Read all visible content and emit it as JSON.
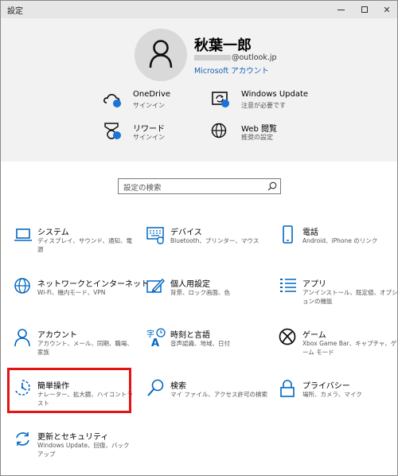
{
  "window": {
    "title": "設定"
  },
  "account": {
    "name": "秋葉一郎",
    "email_domain": "@outlook.jp",
    "ms_account_link": "Microsoft アカウント"
  },
  "quick": [
    {
      "title": "OneDrive",
      "subtitle": "サインイン",
      "icon": "onedrive-icon"
    },
    {
      "title": "Windows Update",
      "subtitle": "注意が必要です",
      "icon": "windows-update-icon"
    },
    {
      "title": "リワード",
      "subtitle": "サインイン",
      "icon": "rewards-icon"
    },
    {
      "title": "Web 閲覧",
      "subtitle": "推奨の設定",
      "icon": "globe-icon"
    }
  ],
  "search": {
    "placeholder": "設定の検索"
  },
  "tiles": [
    {
      "title": "システム",
      "desc": "ディスプレイ、サウンド、通知、電源",
      "icon": "laptop-icon"
    },
    {
      "title": "デバイス",
      "desc": "Bluetooth、プリンター、マウス",
      "icon": "keyboard-icon"
    },
    {
      "title": "電話",
      "desc": "Android、iPhone のリンク",
      "icon": "phone-icon"
    },
    {
      "title": "ネットワークとインターネット",
      "desc": "Wi-Fi、機内モード、VPN",
      "icon": "network-globe-icon"
    },
    {
      "title": "個人用設定",
      "desc": "背景、ロック画面、色",
      "icon": "personalization-icon"
    },
    {
      "title": "アプリ",
      "desc": "アンインストール、既定値、オプションの機能",
      "icon": "apps-list-icon"
    },
    {
      "title": "アカウント",
      "desc": "アカウント、メール、同期、職場、家族",
      "icon": "person-icon"
    },
    {
      "title": "時刻と言語",
      "desc": "音声認識、地域、日付",
      "icon": "time-language-icon"
    },
    {
      "title": "ゲーム",
      "desc": "Xbox Game Bar、キャプチャ、ゲーム モード",
      "icon": "xbox-icon"
    },
    {
      "title": "簡単操作",
      "desc": "ナレーター、拡大鏡、ハイコントラスト",
      "icon": "ease-of-access-icon"
    },
    {
      "title": "検索",
      "desc": "マイ ファイル、アクセス許可の検索",
      "icon": "search-icon"
    },
    {
      "title": "プライバシー",
      "desc": "場所、カメラ、マイク",
      "icon": "lock-icon"
    },
    {
      "title": "更新とセキュリティ",
      "desc": "Windows Update、回復、バックアップ",
      "icon": "update-sync-icon"
    }
  ],
  "colors": {
    "accent": "#0067c0",
    "badge": "#1a73d9",
    "highlight": "#e31414",
    "header_bg": "#f2f2f2"
  }
}
